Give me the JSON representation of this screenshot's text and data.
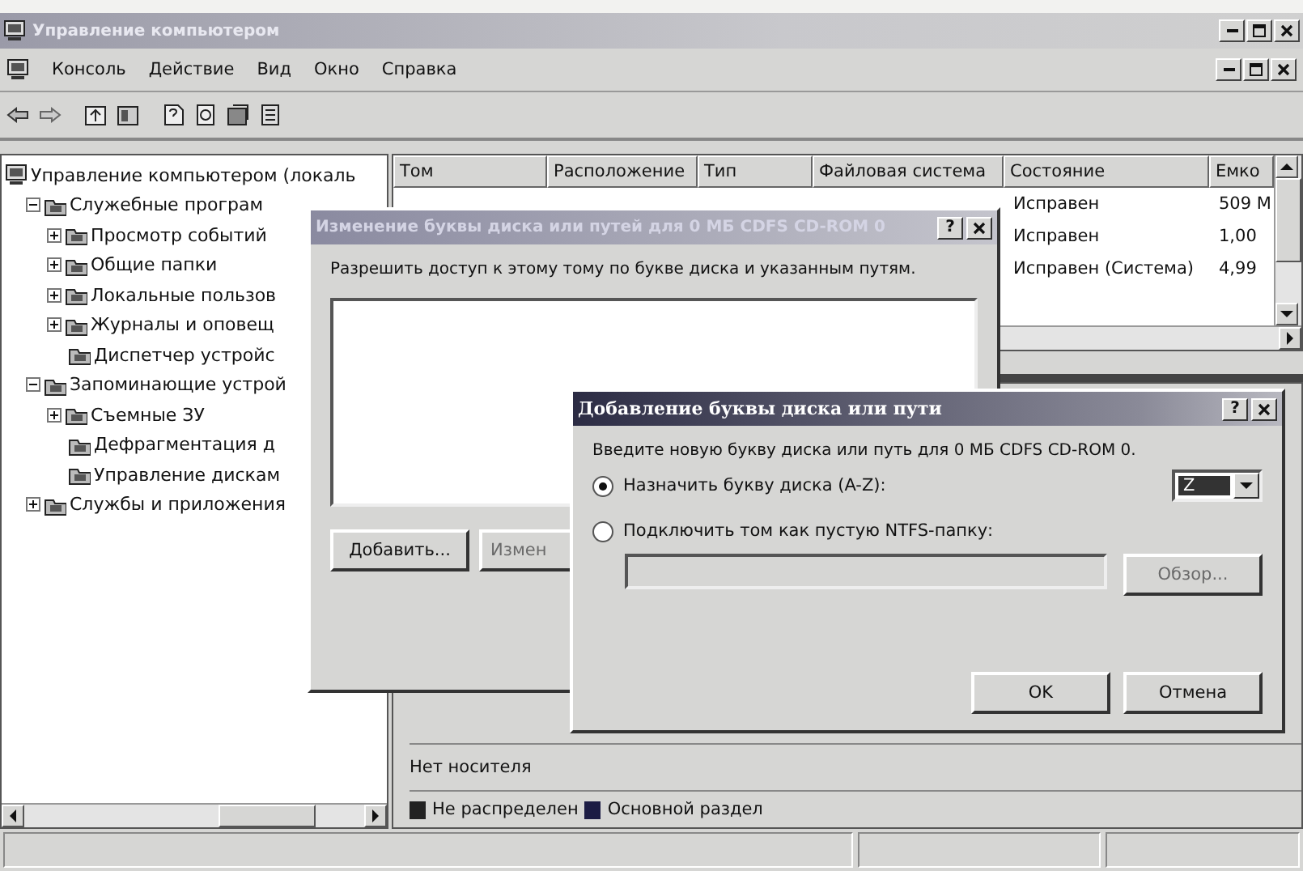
{
  "window": {
    "title": "Управление компьютером"
  },
  "menu": [
    "Консоль",
    "Действие",
    "Вид",
    "Окно",
    "Справка"
  ],
  "tree": [
    {
      "label": "Управление компьютером (локаль",
      "children": [
        {
          "label": "Служебные програм",
          "expanded": true,
          "children": [
            {
              "label": "Просмотр событий",
              "expanded": false
            },
            {
              "label": "Общие папки",
              "expanded": false
            },
            {
              "label": "Локальные пользов",
              "expanded": false
            },
            {
              "label": "Журналы и оповещ",
              "expanded": false
            },
            {
              "label": "Диспетчер устройс"
            }
          ]
        },
        {
          "label": "Запоминающие устрой",
          "expanded": true,
          "children": [
            {
              "label": "Съемные ЗУ",
              "expanded": false
            },
            {
              "label": "Дефрагментация д"
            },
            {
              "label": "Управление дискам"
            }
          ]
        },
        {
          "label": "Службы и приложения",
          "expanded": false
        }
      ]
    }
  ],
  "volumes": {
    "columns": [
      "Том",
      "Расположение",
      "Тип",
      "Файловая система",
      "Состояние",
      "Емко"
    ],
    "rows": [
      {
        "status": "Исправен",
        "capacity": "509 М"
      },
      {
        "status": "Исправен",
        "capacity": "1,00"
      },
      {
        "status": "Исправен (Система)",
        "capacity": "4,99"
      }
    ]
  },
  "disk_view": {
    "rows": [
      {
        "label": "Нет носителя"
      }
    ],
    "legend": [
      {
        "label": "Не распределен",
        "color": "#222222"
      },
      {
        "label": "Основной раздел",
        "color": "#1c1c44"
      }
    ]
  },
  "path_dialog": {
    "title": "Изменение буквы диска или путей для 0 МБ CDFS  CD-ROM 0",
    "help": "?",
    "prompt": "Разрешить доступ к этому тому по букве диска и указанным путям.",
    "buttons": [
      "Добавить...",
      "Измен"
    ]
  },
  "add_dialog": {
    "title": "Добавление буквы диска или пути",
    "help": "?",
    "prompt": "Введите новую букву диска или путь для 0 МБ CDFS  CD-ROM 0.",
    "options": [
      {
        "kind": "letter",
        "label": "Назначить букву диска (A-Z):",
        "selected": true
      },
      {
        "kind": "folder",
        "label": "Подключить том как пустую NTFS-папку:",
        "selected": false
      }
    ],
    "letter": "Z",
    "folder_field": {
      "disabled": true
    },
    "browse": {
      "label": "Обзор...",
      "disabled": true
    },
    "buttons": [
      "OK",
      "Отмена"
    ]
  }
}
